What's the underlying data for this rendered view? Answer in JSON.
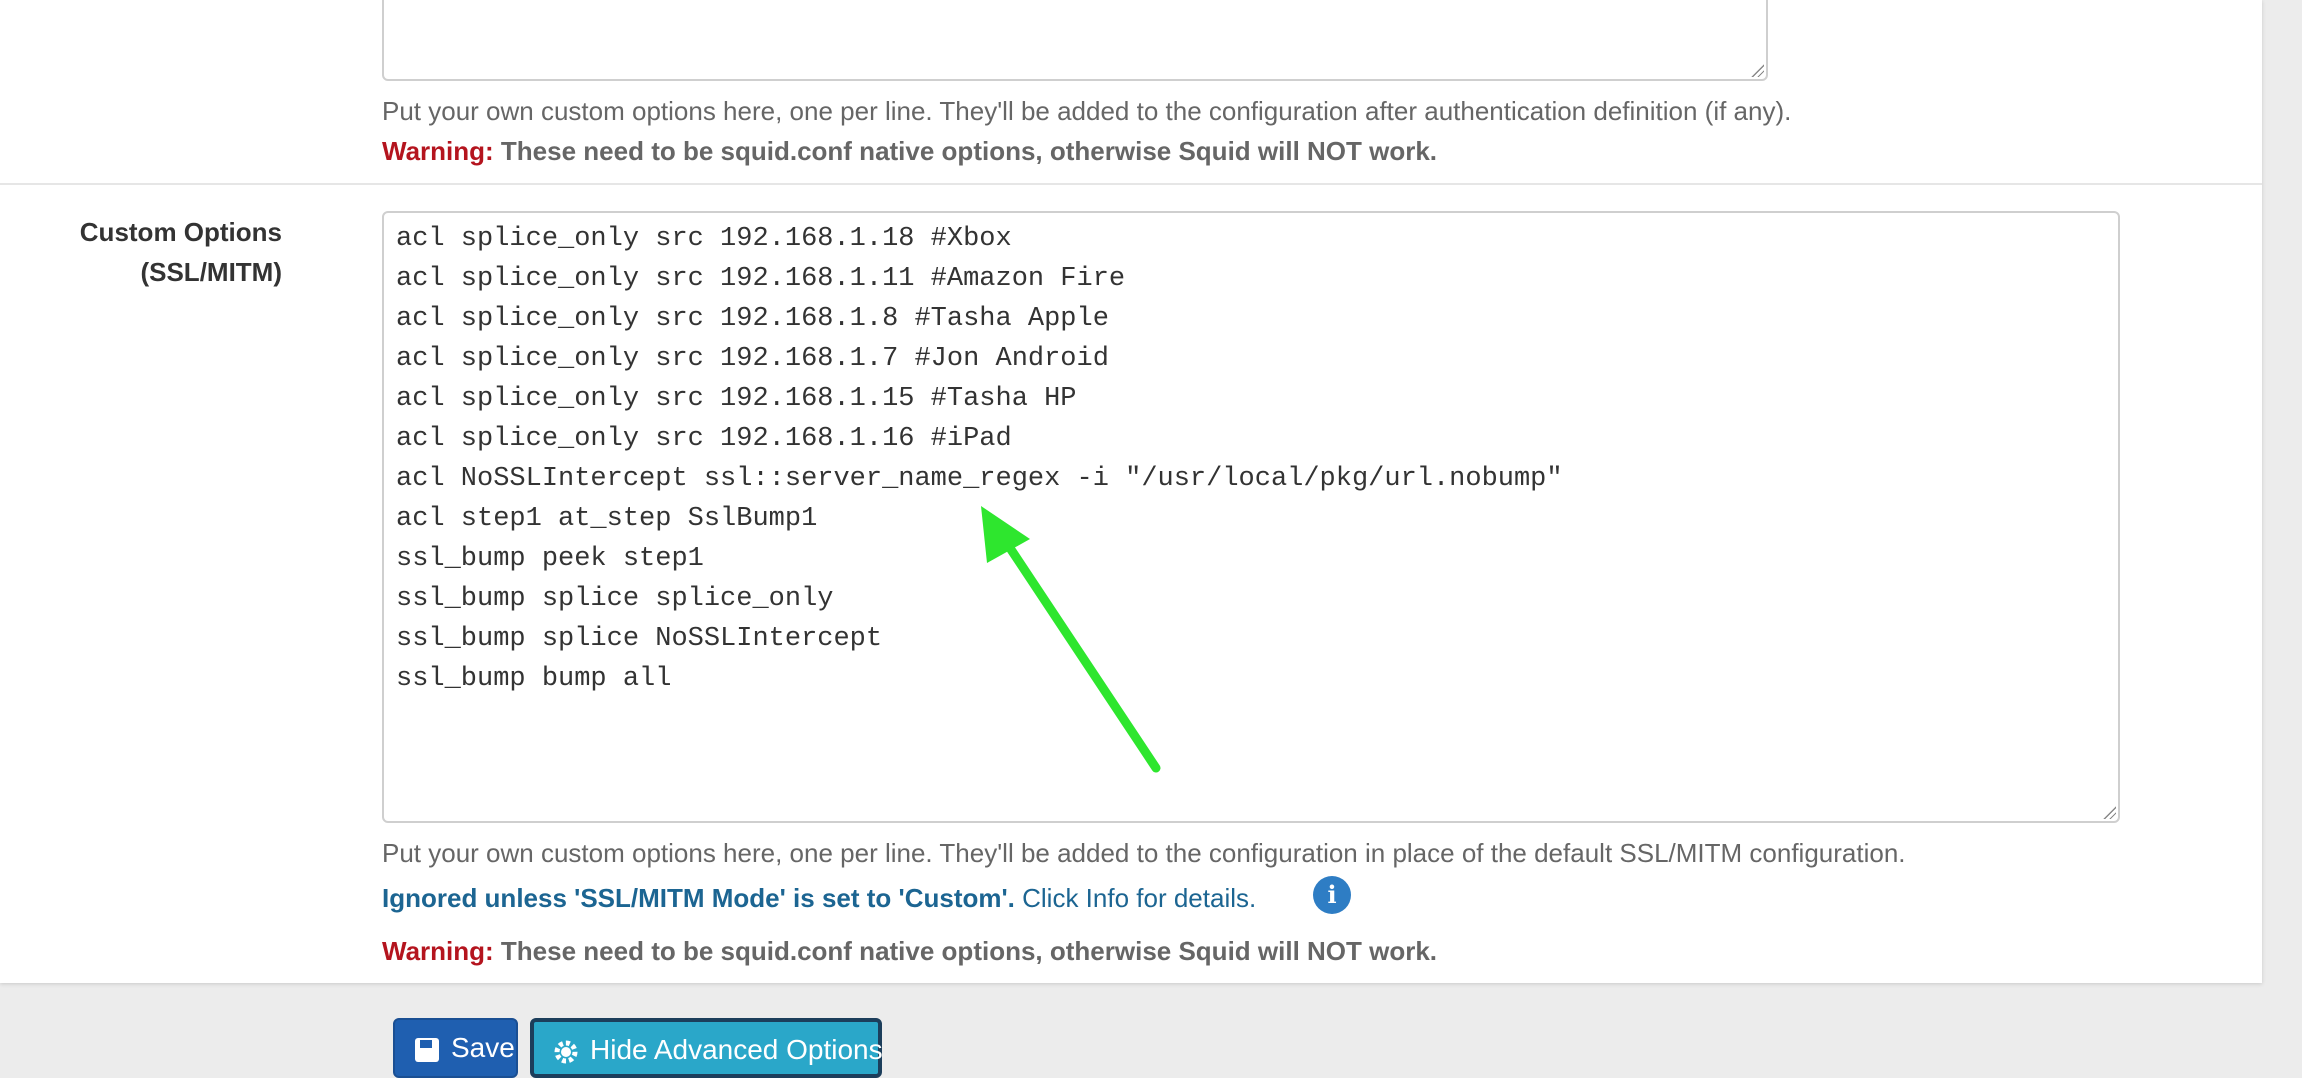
{
  "custom_options_auth": {
    "help_text": "Put your own custom options here, one per line. They'll be added to the configuration after authentication definition (if any).",
    "warning_label": "Warning:",
    "warning_text": "These need to be squid.conf native options, otherwise Squid will NOT work."
  },
  "custom_options_ssl": {
    "label_line1": "Custom Options",
    "label_line2": "(SSL/MITM)",
    "lines": [
      "acl splice_only src 192.168.1.18 #Xbox",
      "acl splice_only src 192.168.1.11 #Amazon Fire",
      "acl splice_only src 192.168.1.8 #Tasha Apple",
      "acl splice_only src 192.168.1.7 #Jon Android",
      "acl splice_only src 192.168.1.15 #Tasha HP",
      "acl splice_only src 192.168.1.16 #iPad",
      "acl NoSSLIntercept ssl::server_name_regex -i \"/usr/local/pkg/url.nobump\"",
      "acl step1 at_step SslBump1",
      "ssl_bump peek step1",
      "ssl_bump splice splice_only",
      "ssl_bump splice NoSSLIntercept",
      "ssl_bump bump all"
    ],
    "help_text": "Put your own custom options here, one per line. They'll be added to the configuration in place of the default SSL/MITM configuration.",
    "ignored_text": "Ignored unless 'SSL/MITM Mode' is set to 'Custom'.",
    "info_link": "Click Info for details.",
    "warning_label": "Warning:",
    "warning_text": "These need to be squid.conf native options, otherwise Squid will NOT work."
  },
  "buttons": {
    "save": "Save",
    "hide_advanced": "Hide Advanced Options"
  },
  "icons": {
    "info": "info-icon",
    "save": "floppy-disk-icon",
    "hide_advanced": "gear-icon"
  },
  "colors": {
    "warning": "#b4141e",
    "link": "#1c6592",
    "annotation_arrow": "#2ee62e"
  }
}
